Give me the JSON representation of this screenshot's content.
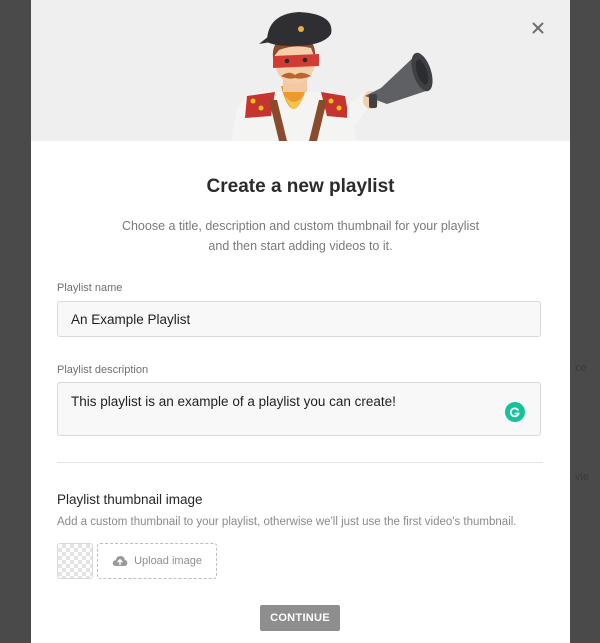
{
  "background": {
    "peek_texts": [
      "ce",
      "vie"
    ]
  },
  "modal": {
    "title": "Create a new playlist",
    "subtitle": "Choose a title, description and custom thumbnail for your playlist and then start adding videos to it.",
    "hero_icon": "mascot-with-megaphone",
    "close_icon": "close-icon"
  },
  "form": {
    "name_label": "Playlist name",
    "name_value": "An Example Playlist",
    "description_label": "Playlist description",
    "description_value": "This playlist is an example of a playlist you can create!",
    "grammarly_icon": "grammarly-icon"
  },
  "thumbnail": {
    "title": "Playlist thumbnail image",
    "help": "Add a custom thumbnail to your playlist, otherwise we'll just use the first video's thumbnail.",
    "upload_label": "Upload image",
    "upload_icon": "cloud-upload-icon"
  },
  "actions": {
    "continue_label": "CONTINUE"
  },
  "colors": {
    "backdrop": "#4a4a4a",
    "hero_bg": "#efefef",
    "continue_bg": "#8e8e8e",
    "grammarly": "#15c39a"
  }
}
